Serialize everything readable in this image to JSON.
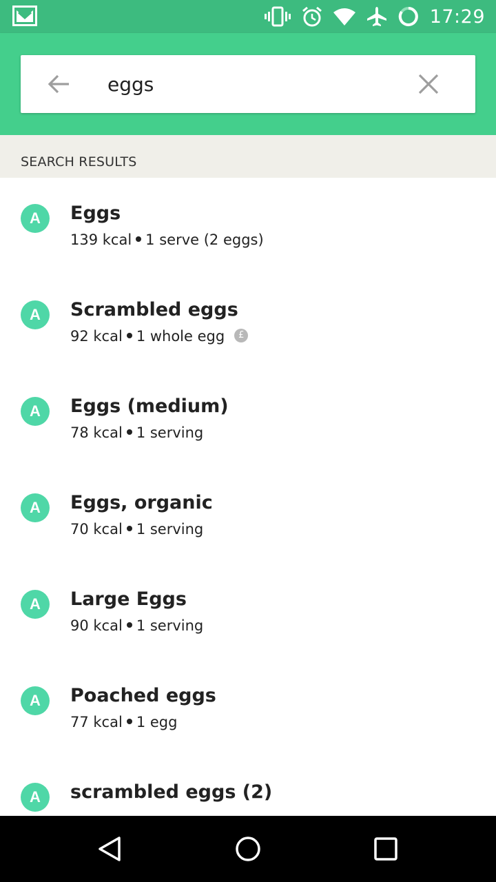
{
  "status_bar": {
    "time": "17:29",
    "icons": [
      "gmail-icon",
      "vibrate-icon",
      "alarm-icon",
      "wifi-icon",
      "airplane-icon",
      "battery-ring-icon"
    ]
  },
  "search": {
    "query": "eggs",
    "back_icon": "arrow-left-icon",
    "clear_icon": "close-icon"
  },
  "section": {
    "header": "SEARCH RESULTS"
  },
  "results": [
    {
      "badge": "A",
      "name": "Eggs",
      "kcal": "139 kcal",
      "serving": "1 serve (2 eggs)",
      "coin": false
    },
    {
      "badge": "A",
      "name": "Scrambled eggs",
      "kcal": "92 kcal",
      "serving": "1 whole egg",
      "coin": true
    },
    {
      "badge": "A",
      "name": "Eggs (medium)",
      "kcal": "78 kcal",
      "serving": "1 serving",
      "coin": false
    },
    {
      "badge": "A",
      "name": "Eggs, organic",
      "kcal": "70 kcal",
      "serving": "1 serving",
      "coin": false
    },
    {
      "badge": "A",
      "name": "Large Eggs",
      "kcal": "90 kcal",
      "serving": "1 serving",
      "coin": false
    },
    {
      "badge": "A",
      "name": "Poached eggs",
      "kcal": "77 kcal",
      "serving": "1 egg",
      "coin": false
    },
    {
      "badge": "A",
      "name": "scrambled eggs (2)",
      "kcal": "",
      "serving": "",
      "coin": false
    }
  ],
  "colors": {
    "status_bar": "#3dbb7f",
    "app_bar": "#44cf8c",
    "badge": "#4fd7a7",
    "section_bg": "#f0efe9"
  },
  "nav": {
    "icons": [
      "back-triangle-icon",
      "home-circle-icon",
      "recents-square-icon"
    ]
  }
}
